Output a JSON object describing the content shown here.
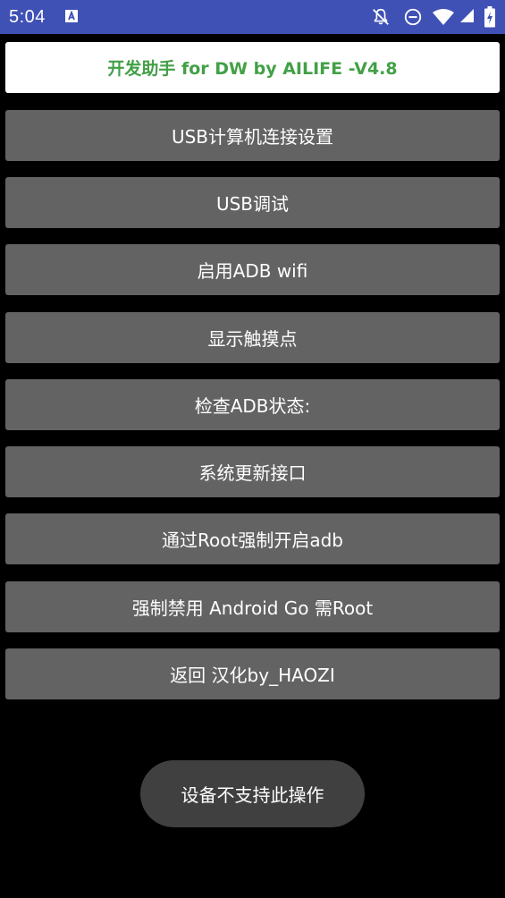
{
  "status_bar": {
    "time": "5:04",
    "icons": [
      "font-a-icon",
      "notifications-off-icon",
      "do-not-disturb-icon",
      "wifi-icon",
      "battery-charging-icon"
    ]
  },
  "app": {
    "title": "开发助手 for DW by AILIFE -V4.8",
    "title_color": "#43a047"
  },
  "menu": {
    "items": [
      {
        "label": "USB计算机连接设置"
      },
      {
        "label": "USB调试"
      },
      {
        "label": "启用ADB wifi"
      },
      {
        "label": "显示触摸点"
      },
      {
        "label": "检查ADB状态:"
      },
      {
        "label": "系统更新接口"
      },
      {
        "label": "通过Root强制开启adb"
      },
      {
        "label": "强制禁用 Android Go 需Root"
      },
      {
        "label": "返回 汉化by_HAOZI"
      }
    ]
  },
  "toast": {
    "message": "设备不支持此操作"
  },
  "colors": {
    "status_bar": "#3f51b5",
    "button": "#636363",
    "background": "#000000",
    "toast": "#404040"
  }
}
